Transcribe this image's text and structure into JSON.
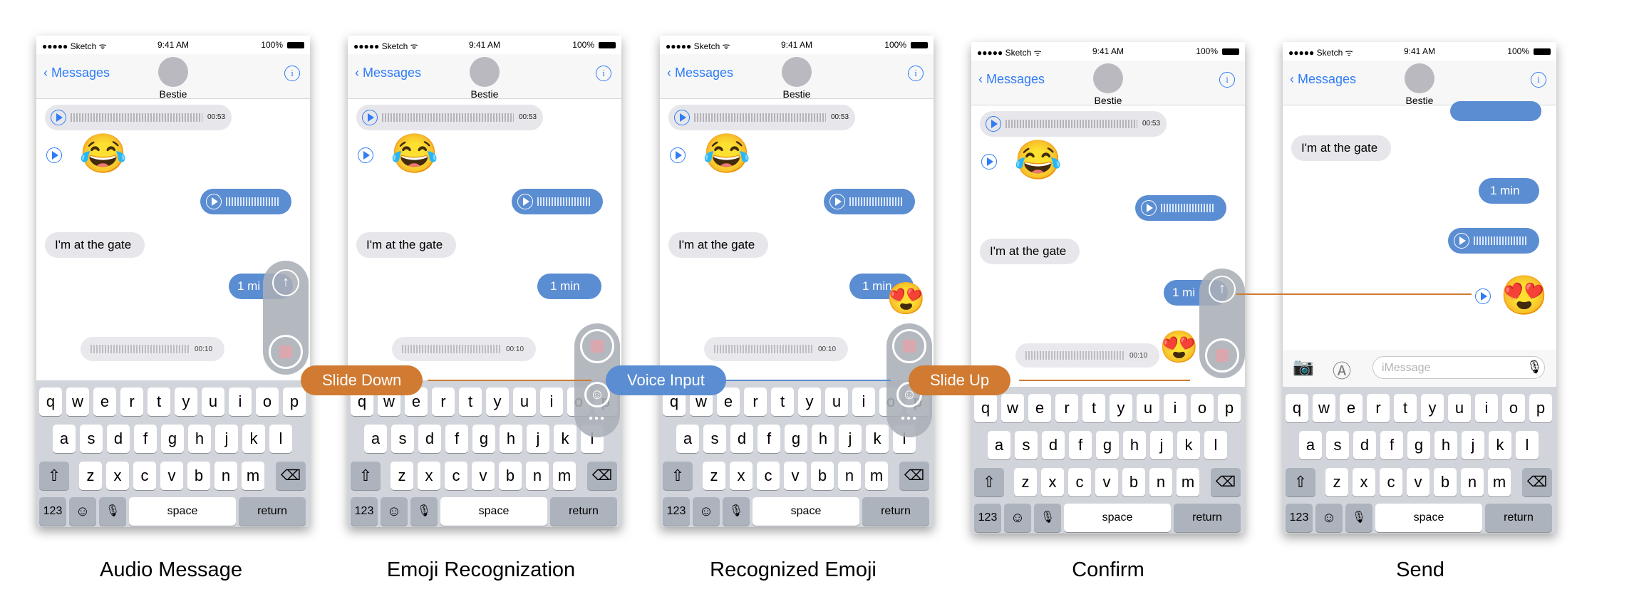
{
  "status": {
    "carrier": "●●●●● Sketch ᯤ",
    "time": "9:41 AM",
    "battery": "100%"
  },
  "nav": {
    "back": "Messages",
    "contact": "Bestie",
    "info": "i"
  },
  "messages": {
    "audio_duration": "00:53",
    "gate": "I'm at the gate",
    "one_min": "1 min",
    "one_min_cut": "1 mi",
    "recording_duration": "00:10",
    "imessage_placeholder": "iMessage"
  },
  "keyboard": {
    "row1": [
      "q",
      "w",
      "e",
      "r",
      "t",
      "y",
      "u",
      "i",
      "o",
      "p"
    ],
    "row2": [
      "a",
      "s",
      "d",
      "f",
      "g",
      "h",
      "j",
      "k",
      "l"
    ],
    "row3": [
      "z",
      "x",
      "c",
      "v",
      "b",
      "n",
      "m"
    ],
    "numbers": "123",
    "space": "space",
    "return": "return"
  },
  "flow": {
    "slide_down": "Slide Down",
    "voice_input": "Voice Input",
    "slide_up": "Slide Up"
  },
  "captions": [
    "Audio Message",
    "Emoji Recognization",
    "Recognized Emoji",
    "Confirm",
    "Send"
  ],
  "icons": {
    "laugh": "😂",
    "heart_eyes": "😍",
    "smiley": "☺",
    "send_arrow": "↑",
    "shift": "⇧",
    "delete": "⌫",
    "emoji_key": "☺",
    "mic": "🎙",
    "camera": "📷",
    "appstore": "Ⓐ"
  },
  "colors": {
    "accent_blue": "#2f7cf6",
    "bubble_blue": "#5b8dd2",
    "flow_orange": "#d07a32",
    "keyboard_gray": "#d1d4da"
  }
}
